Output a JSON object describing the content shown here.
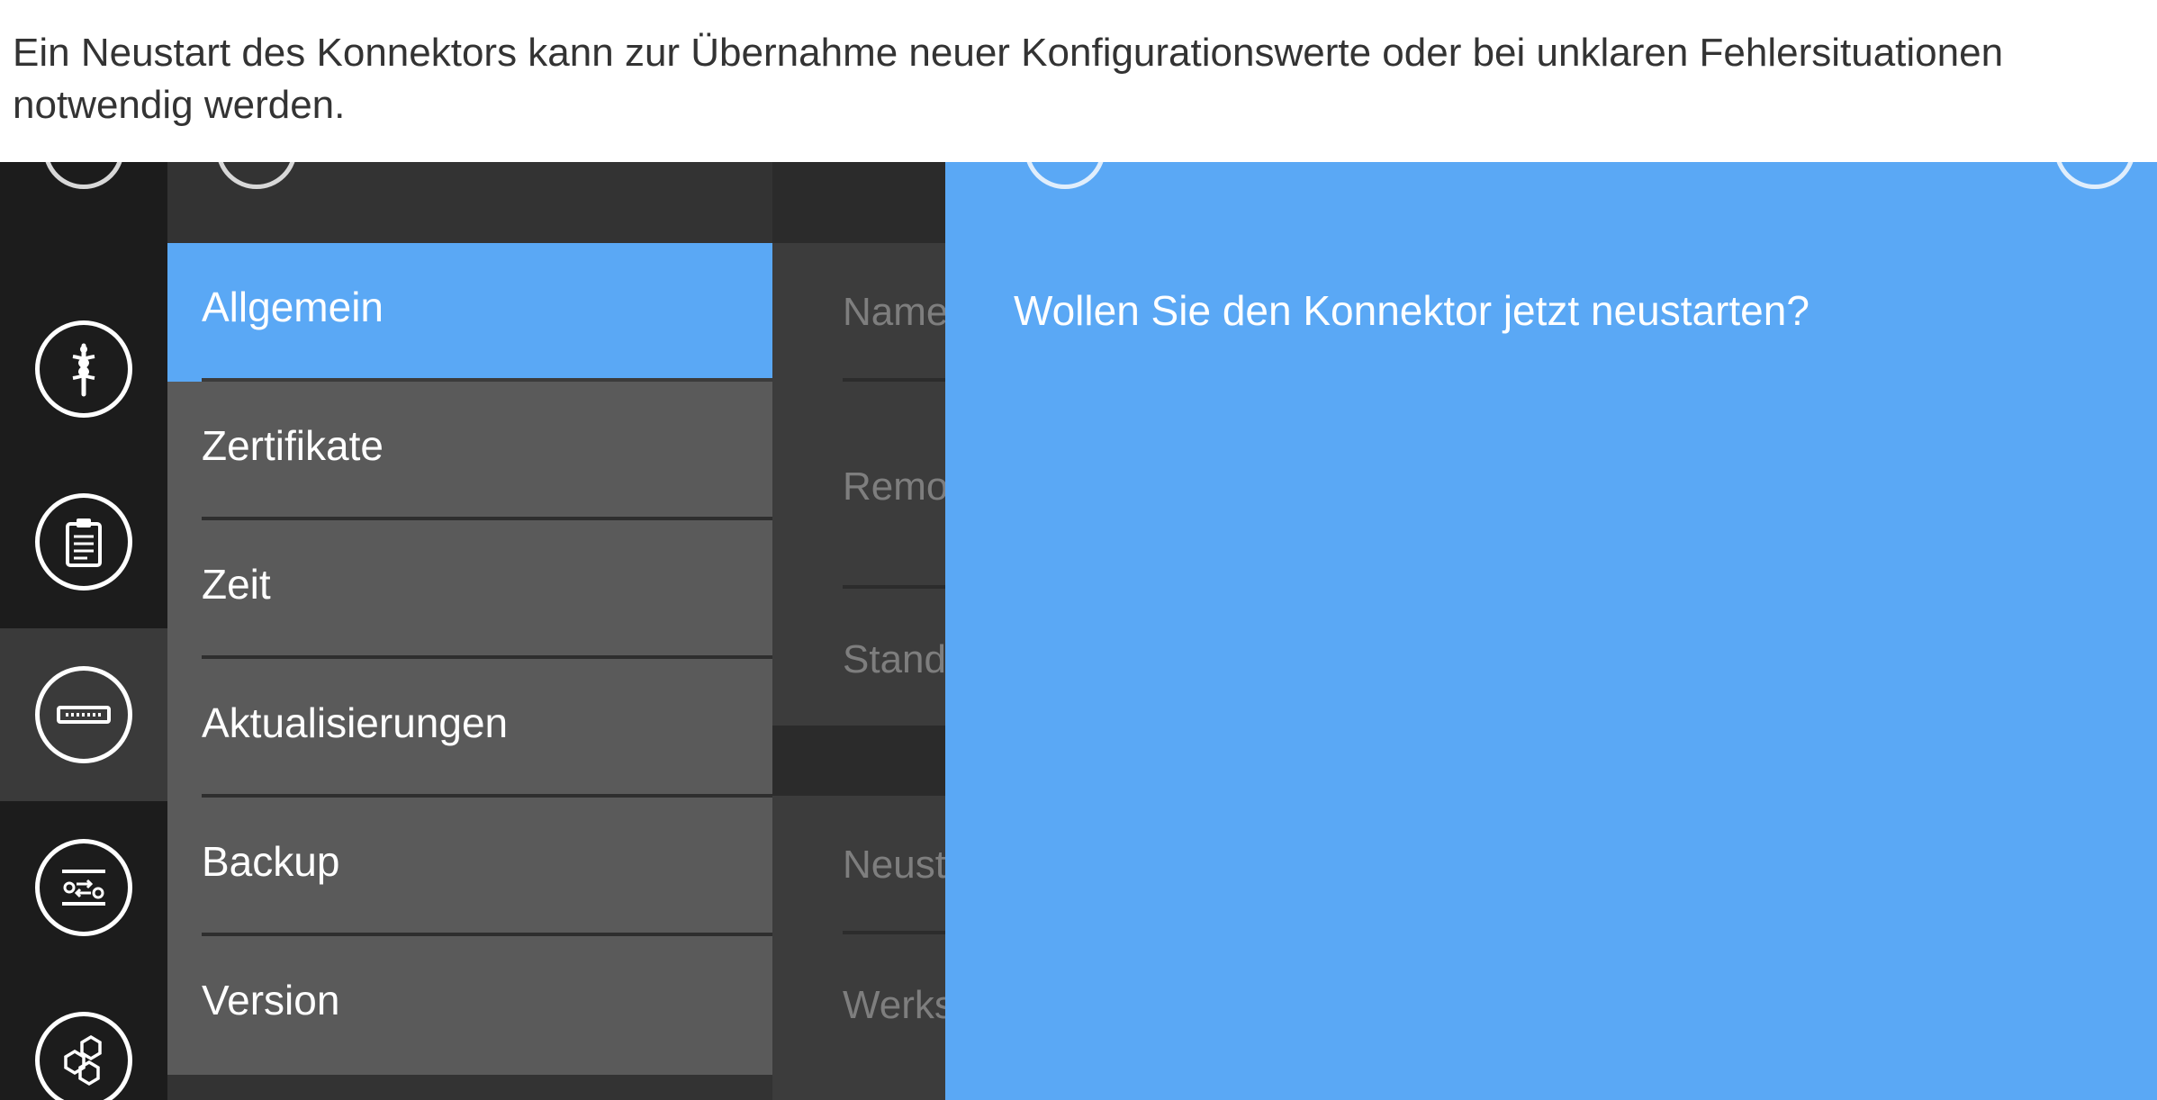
{
  "caption": {
    "text": "Ein Neustart des Konnektors kann zur Übernahme neuer Konfigurationswerte oder bei unklaren Fehlersituationen notwendig werden."
  },
  "rail": {
    "items": [
      {
        "icon": "caduceus-icon"
      },
      {
        "icon": "clipboard-icon"
      },
      {
        "icon": "connector-device-icon",
        "active": true
      },
      {
        "icon": "switch-settings-icon"
      },
      {
        "icon": "hexagons-icon"
      }
    ]
  },
  "submenu": {
    "items": [
      {
        "label": "Allgemein",
        "active": true
      },
      {
        "label": "Zertifikate"
      },
      {
        "label": "Zeit"
      },
      {
        "label": "Aktualisierungen"
      },
      {
        "label": "Backup"
      },
      {
        "label": "Version"
      }
    ]
  },
  "content": {
    "fields": [
      "Name",
      "Remo",
      "Stand",
      "Neust",
      "Werks"
    ]
  },
  "dialog": {
    "question": "Wollen Sie den Konnektor jetzt neustarten?"
  },
  "colors": {
    "accent": "#5aa8f5",
    "rail_bg": "#1c1c1c",
    "menu_bg": "#5a5a5a"
  }
}
